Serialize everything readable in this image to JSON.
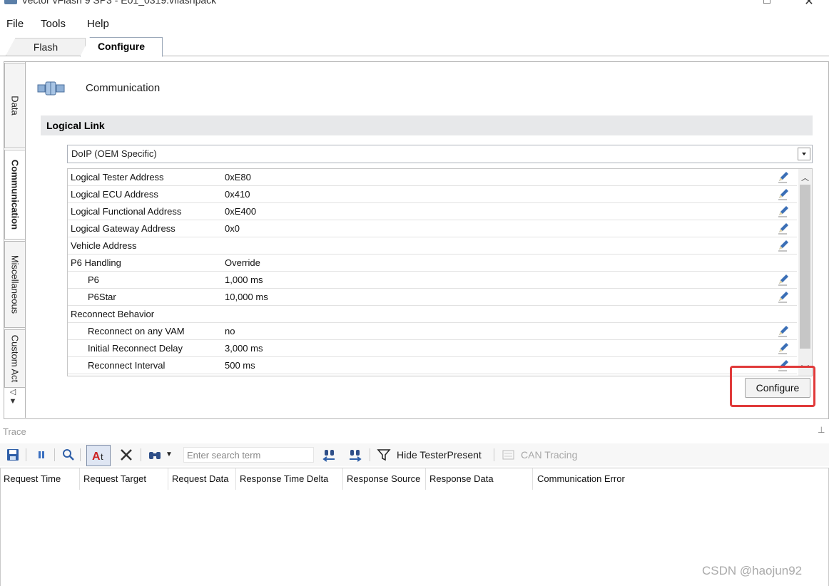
{
  "window": {
    "title": "Vector vFlash 9 SP3 - E01_0319.vflashpack"
  },
  "menu": {
    "items": [
      "File",
      "Tools",
      "Help"
    ]
  },
  "tabs": {
    "flash": "Flash",
    "configure": "Configure"
  },
  "side_tabs": {
    "data": "Data",
    "communication": "Communication",
    "miscellaneous": "Miscellaneous",
    "custom": "Custom Act"
  },
  "comm": {
    "title": "Communication"
  },
  "logical_link": {
    "section_title": "Logical Link",
    "selected": "DoIP (OEM Specific)",
    "properties": [
      {
        "name": "Logical Tester Address",
        "value": "0xE80"
      },
      {
        "name": "Logical ECU Address",
        "value": "0x410"
      },
      {
        "name": "Logical Functional Address",
        "value": "0xE400"
      },
      {
        "name": "Logical Gateway Address",
        "value": "0x0"
      },
      {
        "name": "Vehicle Address",
        "value": ""
      },
      {
        "name": "P6 Handling",
        "value": "Override"
      },
      {
        "name": "P6",
        "value": "1,000 ms"
      },
      {
        "name": "P6Star",
        "value": "10,000 ms"
      },
      {
        "name": "Reconnect Behavior",
        "value": ""
      },
      {
        "name": "Reconnect on any VAM",
        "value": "no"
      },
      {
        "name": "Initial Reconnect Delay",
        "value": "3,000 ms"
      },
      {
        "name": "Reconnect Interval",
        "value": "500 ms"
      }
    ],
    "configure_label": "Configure"
  },
  "trace": {
    "title": "Trace",
    "search_placeholder": "Enter search term",
    "hide_tester_present": "Hide TesterPresent",
    "can_tracing": "CAN Tracing",
    "columns": [
      "Request Time",
      "Request Target",
      "Request Data",
      "Response Time Delta",
      "Response Source",
      "Response Data",
      "Communication Error"
    ]
  },
  "watermark": "CSDN @haojun92",
  "colors": {
    "highlight": "#e03a3a",
    "section_band": "#e7e8ea",
    "pencil": "#3b6fb6"
  }
}
